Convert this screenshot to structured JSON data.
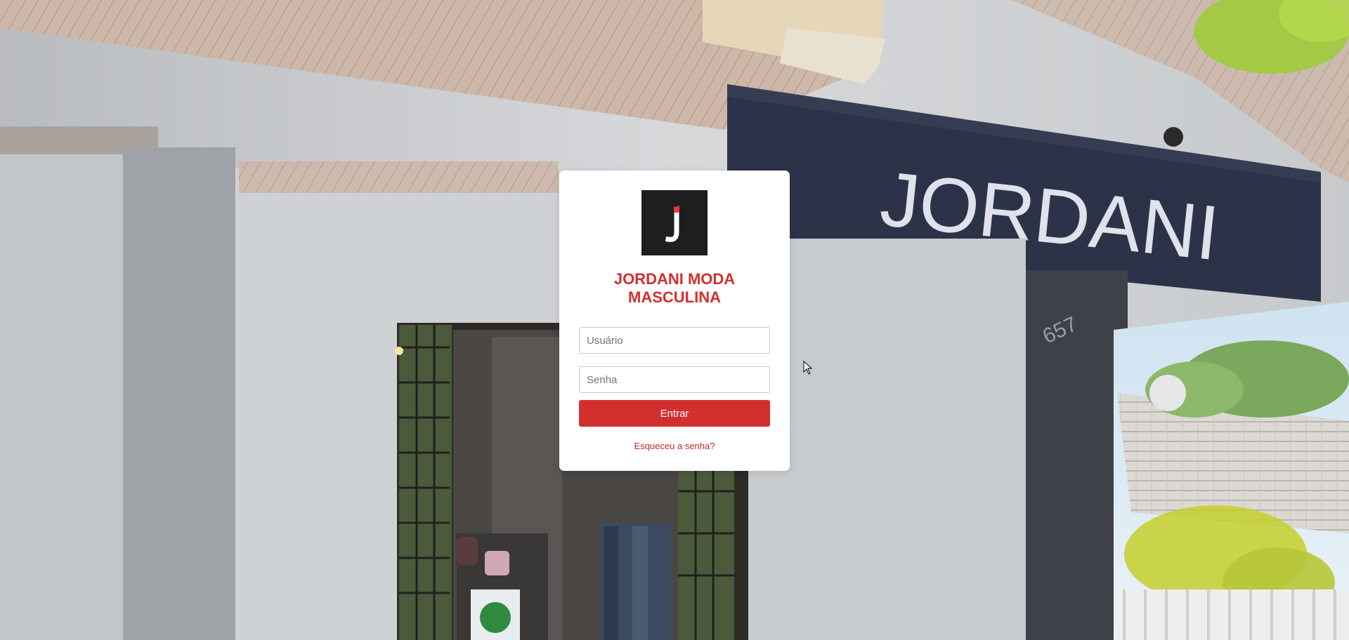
{
  "background": {
    "description_icon": "storefront-photo",
    "sign_text": "JORDANI",
    "house_number": "657"
  },
  "login": {
    "logo_letter": "J",
    "title": "JORDANI MODA MASCULINA",
    "username_placeholder": "Usuário",
    "password_placeholder": "Senha",
    "submit_label": "Entrar",
    "forgot_label": "Esqueceu a senha?"
  },
  "colors": {
    "accent": "#d32f2f",
    "logo_bg": "#1e1e1e",
    "card_bg": "#ffffff"
  }
}
